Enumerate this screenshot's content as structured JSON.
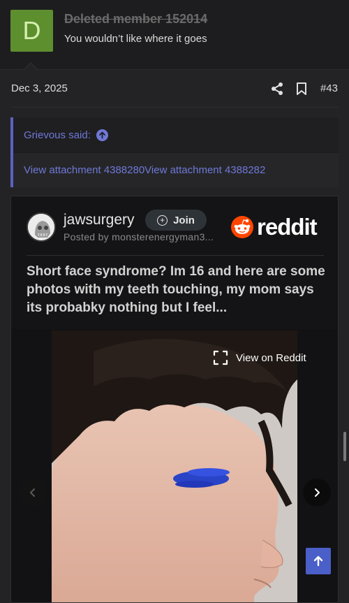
{
  "prev_post": {
    "avatar_letter": "D",
    "author": "Deleted member 152014",
    "text": "You wouldn’t like where it goes"
  },
  "post": {
    "date": "Dec 3, 2025",
    "number": "#43",
    "share_icon": "share-icon",
    "bookmark_icon": "bookmark-icon"
  },
  "quote": {
    "author_line": "Grievous said:",
    "attachments": "View attachment 4388280View attachment 4388282"
  },
  "reddit_embed": {
    "subreddit": "jawsurgery",
    "posted_by": "Posted by monsterenergyman3...",
    "join_label": "Join",
    "logo_text": "reddit",
    "title": "Short face syndrome? Im 16 and here are some photos with my teeth touching, my mom says its probabky nothing but I feel...",
    "view_on_reddit": "View on Reddit"
  },
  "colors": {
    "link": "#6f78d8",
    "avatar_bg": "#5e8f2e",
    "reddit_orange": "#ff4500",
    "scroll_top_bg": "#4a5fc8"
  }
}
